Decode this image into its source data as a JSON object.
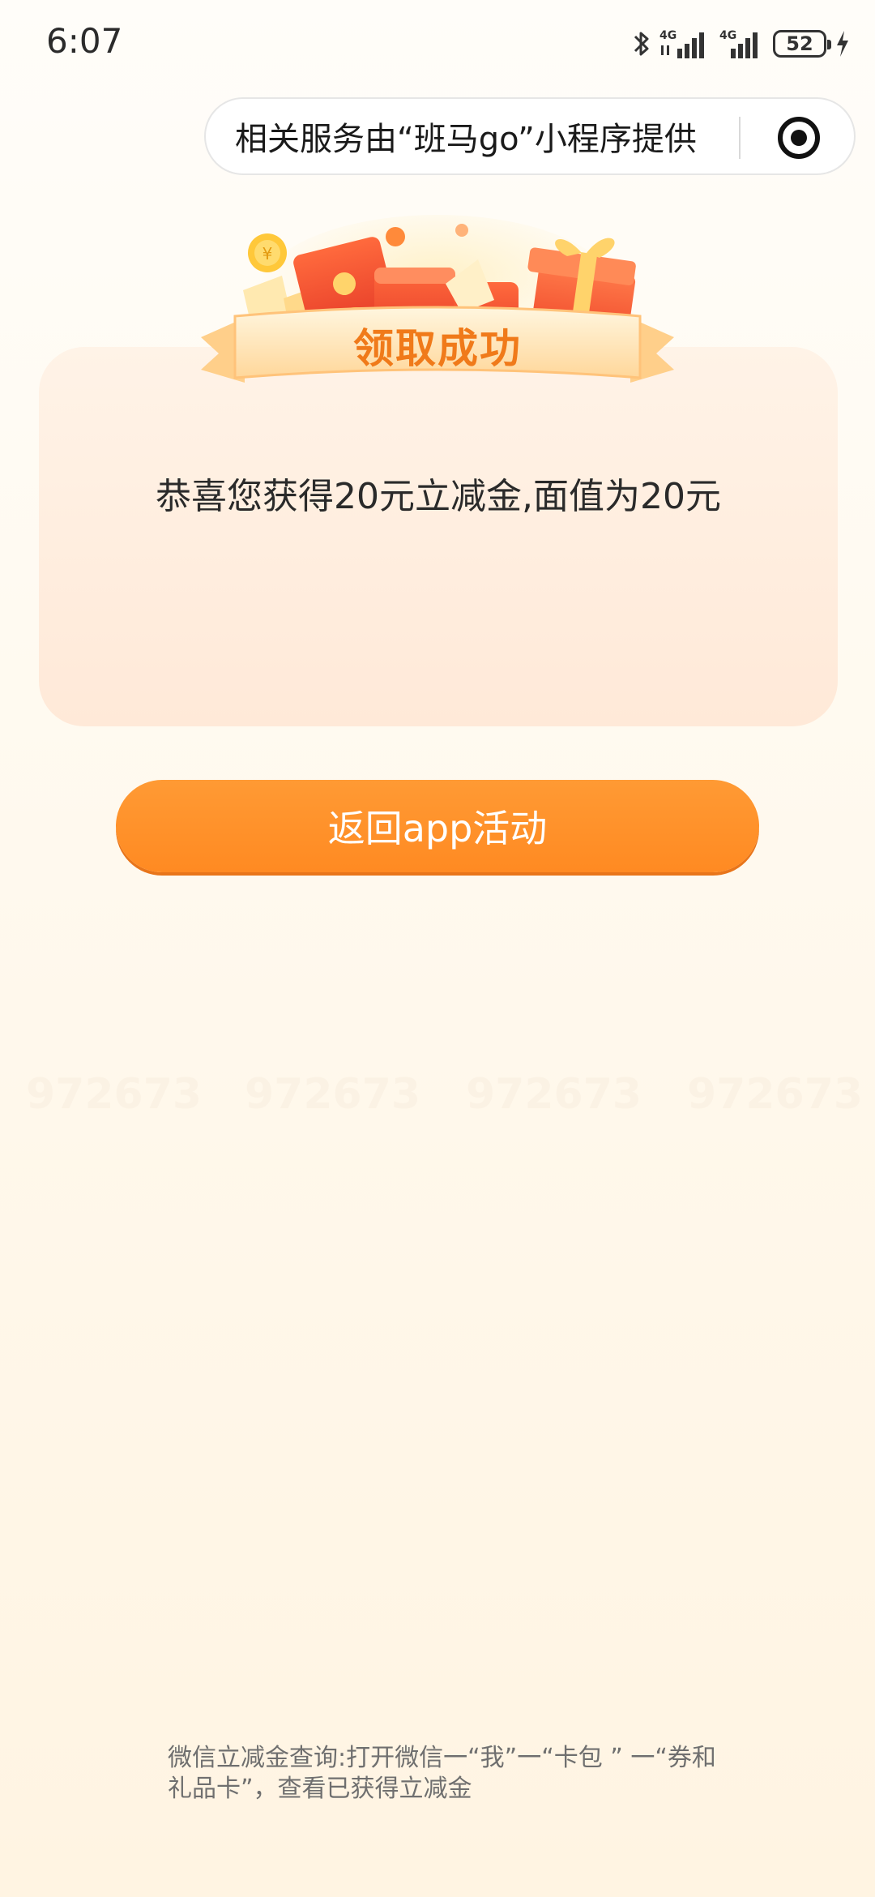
{
  "status_bar": {
    "time": "6:07",
    "network_1": "4G",
    "network_2": "4G",
    "battery_level": "52",
    "icons": [
      "bluetooth-icon",
      "signal-icon",
      "signal-icon",
      "battery-icon",
      "charging-icon"
    ]
  },
  "capsule": {
    "provider_text": "相关服务由“班马go”小程序提供",
    "icon": "target-icon"
  },
  "banner": {
    "title": "领取成功",
    "icons": [
      "coin-icon",
      "red-envelope-icon",
      "gift-box-icon"
    ]
  },
  "card": {
    "message": "恭喜您获得20元立减金,面值为20元"
  },
  "watermark": {
    "text": "972673"
  },
  "actions": {
    "back_label": "返回app活动"
  },
  "footer": {
    "note_line1": "微信立减金查询:打开微信一“我”一“卡包 ” 一“券和",
    "note_line2": "礼品卡”，查看已获得立减金"
  },
  "colors": {
    "accent": "#ff8c26",
    "banner_text": "#f07a1a",
    "card_bg": "#ffede0"
  }
}
